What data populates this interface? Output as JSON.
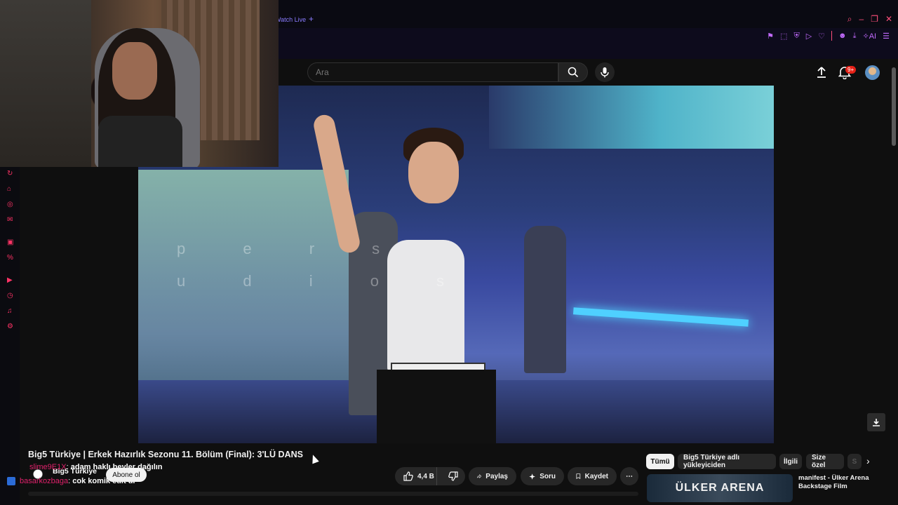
{
  "browser": {
    "tab_label": "Watch Live",
    "new_tab": "+"
  },
  "search": {
    "placeholder": "Ara"
  },
  "header": {
    "notification_badge": "9+"
  },
  "video": {
    "watermark_top": "p e r s",
    "watermark_bottom": "u d i o s"
  },
  "info": {
    "title": "Big5 Türkiye | Erkek Hazırlık Sezonu 11. Bölüm (Final): 3'LÜ DANS",
    "channel_name": "Big5 Türkiye",
    "subscribe_label": "Abone ol",
    "like_count": "4,4 B",
    "share_label": "Paylaş",
    "ask_label": "Soru",
    "save_label": "Kaydet"
  },
  "chat": [
    {
      "user": "slime9E1X",
      "message": "adam haklı beyler dağılın"
    },
    {
      "user": "basarkozbaga",
      "message": "cok komik edit di"
    }
  ],
  "chips": [
    {
      "label": "Tümü",
      "active": true
    },
    {
      "label": "Big5 Türkiye adlı yükleyiciden",
      "active": false
    },
    {
      "label": "İlgili",
      "active": false
    },
    {
      "label": "Size özel",
      "active": false
    },
    {
      "label": "S",
      "active": false
    }
  ],
  "recommended": {
    "thumb_text": "ÜLKER ARENA",
    "title": "manifest - Ülker Arena Backstage Film"
  },
  "colors": {
    "accent": "#ff3366",
    "extension": "#c36bff",
    "background": "#0f0f0f"
  }
}
